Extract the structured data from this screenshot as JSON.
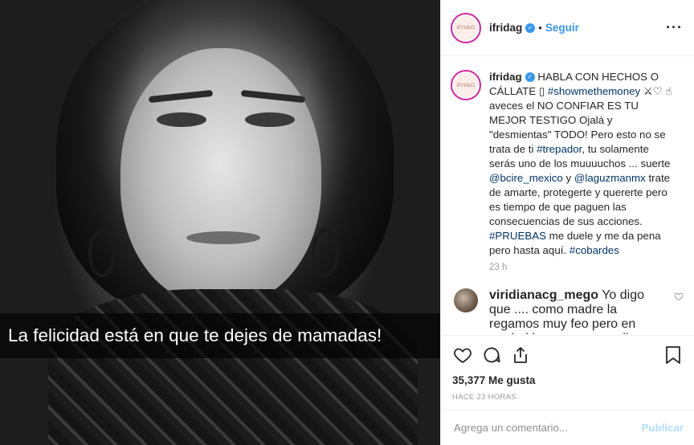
{
  "post": {
    "caption_overlay": "La felicidad está en que te dejes de mamadas!"
  },
  "header": {
    "username": "ifridag",
    "separator": "•",
    "follow_label": "Seguir",
    "more_label": "···",
    "avatar_text": "iFridaG"
  },
  "caption": {
    "username": "ifridag",
    "text_1": "HABLA CON HECHOS O CÁLLATE ▯ ",
    "tag_1": "#showmethemoney",
    "text_2": " ⚔♡ ☝ aveces el NO CONFIAR ES TU MEJOR TESTIGO Ojalá y \"desmientas\" TODO! Pero esto no se trata de ti ",
    "tag_2": "#trepador",
    "text_3": ", tu solamente serás uno de los muuuuchos ... suerte ",
    "tag_3": "@bcire_mexico",
    "text_4": " y ",
    "tag_4": "@laguzmanmx",
    "text_5": " trate de amarte, protegerte y quererte pero es tiempo de que paguen las consecuencias de sus acciones. ",
    "tag_5": "#PRUEBAS",
    "text_6": " me duele y me da pena pero hasta aquí. ",
    "tag_6": "#cobardes",
    "timestamp": "23 h"
  },
  "reply": {
    "username": "viridianacg_mego",
    "text": " Yo digo que .... como madre la regamos muy feo pero en verdad has cosas que dices; yo como madre nunca"
  },
  "actions": {
    "icons": [
      "heart-icon",
      "comment-icon",
      "share-icon",
      "bookmark-icon"
    ],
    "likes": "35,377 Me gusta",
    "ago": "HACE 23 HORAS"
  },
  "add_comment": {
    "placeholder": "Agrega un comentario...",
    "publish_label": "Publicar"
  },
  "colors": {
    "link": "#3897f0",
    "tag": "#003569",
    "muted": "#999999",
    "publish_disabled": "#b2dffc"
  }
}
